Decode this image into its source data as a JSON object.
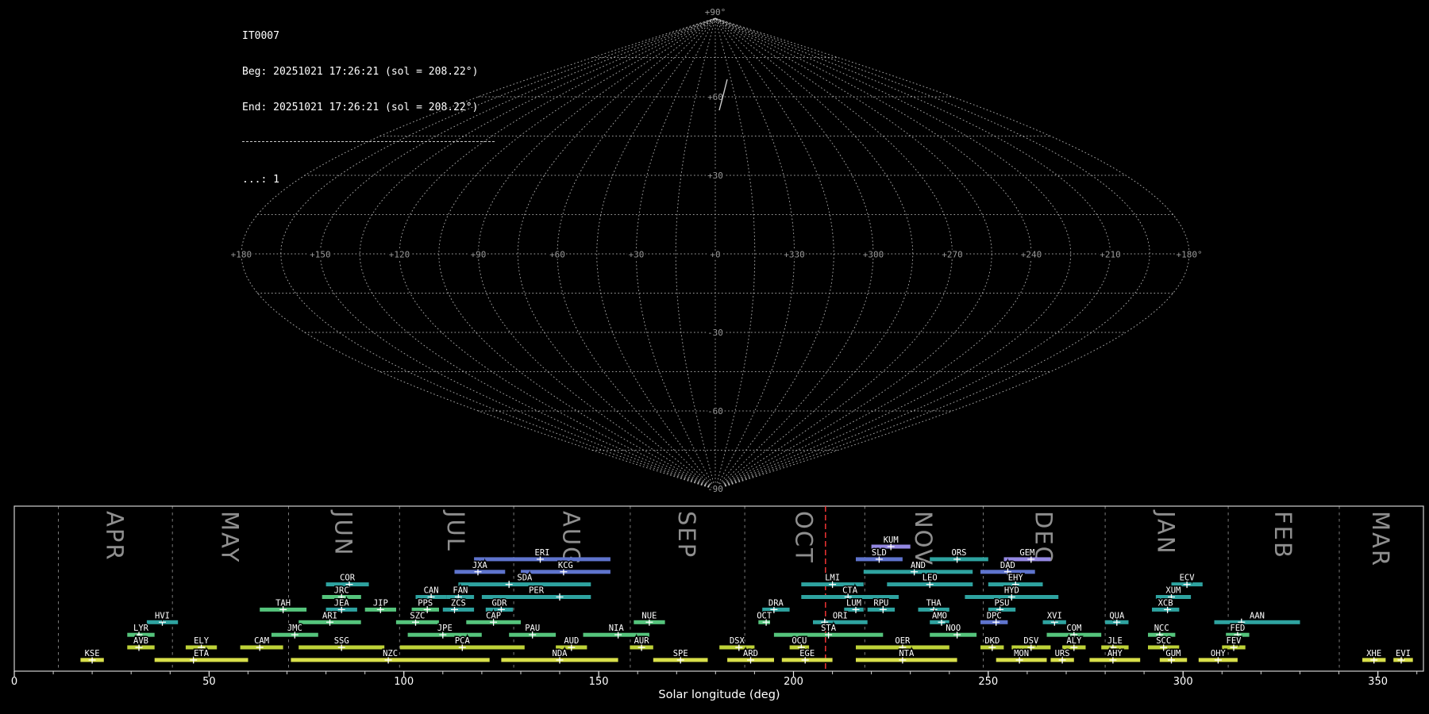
{
  "header": {
    "station": "IT0007",
    "beg_line": "Beg: 20251021 17:26:21 (sol = 208.22°)",
    "end_line": "End: 20251021 17:26:21 (sol = 208.22°)",
    "count_line": "...: 1"
  },
  "sky_map": {
    "projection": "sinusoidal",
    "grid_step_deg": 15,
    "grid_color": "#c9c9c9",
    "label_color": "#9a9a9a",
    "lon_labels": [
      {
        "lon": 180,
        "text": "+180"
      },
      {
        "lon": 150,
        "text": "+150"
      },
      {
        "lon": 120,
        "text": "+120"
      },
      {
        "lon": 90,
        "text": "+90"
      },
      {
        "lon": 60,
        "text": "+60"
      },
      {
        "lon": 30,
        "text": "+30"
      },
      {
        "lon": 0,
        "text": "+0"
      },
      {
        "lon": -30,
        "text": "+330"
      },
      {
        "lon": -60,
        "text": "+300"
      },
      {
        "lon": -90,
        "text": "+270"
      },
      {
        "lon": -120,
        "text": "+240"
      },
      {
        "lon": -150,
        "text": "+210"
      },
      {
        "lon": -180,
        "text": "+180°"
      }
    ],
    "lat_labels": [
      {
        "lat": 90,
        "text": "+90°"
      },
      {
        "lat": 60,
        "text": "+60"
      },
      {
        "lat": 30,
        "text": "+30"
      },
      {
        "lat": -30,
        "text": "-30"
      },
      {
        "lat": -60,
        "text": "-60"
      },
      {
        "lat": -90,
        "text": "-90"
      }
    ],
    "track_points": [
      [
        916,
        100
      ],
      [
        911,
        120
      ],
      [
        906,
        139
      ]
    ],
    "track_color": "#d8d8d8"
  },
  "chart_data": {
    "type": "gantt-timeline",
    "title": "Meteor shower activity periods vs solar longitude",
    "xlabel": "Solar longitude (deg)",
    "x_range": [
      0,
      361.7
    ],
    "x_major_ticks": [
      0,
      50,
      100,
      150,
      200,
      250,
      300,
      350
    ],
    "x_minor_step": 10,
    "grid": "month-boundaries-dashed",
    "current_solar_longitude": 208.22,
    "current_line_color": "#f03434",
    "frame_color": "#d0d0d0",
    "month_line_color": "#909090",
    "month_label_color": "#8f8f8f",
    "shower_label_color": "#ffffff",
    "months": [
      {
        "label": "APR",
        "start": 11.3,
        "end": 40.6
      },
      {
        "label": "MAY",
        "start": 40.6,
        "end": 70.4
      },
      {
        "label": "JUN",
        "start": 70.4,
        "end": 98.9
      },
      {
        "label": "JUL",
        "start": 98.9,
        "end": 128.2
      },
      {
        "label": "AUG",
        "start": 128.2,
        "end": 158.1
      },
      {
        "label": "SEP",
        "start": 158.1,
        "end": 187.5
      },
      {
        "label": "OCT",
        "start": 187.5,
        "end": 218.3
      },
      {
        "label": "NOV",
        "start": 218.3,
        "end": 248.7
      },
      {
        "label": "DEC",
        "start": 248.7,
        "end": 280.0
      },
      {
        "label": "JAN",
        "start": 280.0,
        "end": 311.6
      },
      {
        "label": "FEB",
        "start": 311.6,
        "end": 340.1
      },
      {
        "label": "MAR",
        "start": 340.1,
        "end": 361.7
      }
    ],
    "palette": {
      "yellow": "#d8df4a",
      "chartreuse": "#bed238",
      "green": "#55c47c",
      "teal": "#2ea3a0",
      "blue": "#5f74cd",
      "purple": "#9488e2"
    },
    "showers": [
      {
        "code": "KUM",
        "row": 0,
        "start": 220,
        "end": 230,
        "peak": 225,
        "color": "purple"
      },
      {
        "code": "ERI",
        "row": 1,
        "start": 118,
        "end": 153,
        "peak": 135,
        "color": "blue"
      },
      {
        "code": "SLD",
        "row": 1,
        "start": 216,
        "end": 228,
        "peak": 222,
        "color": "blue"
      },
      {
        "code": "ORS",
        "row": 1,
        "start": 235,
        "end": 250,
        "peak": 242,
        "color": "teal"
      },
      {
        "code": "GEM",
        "row": 1,
        "start": 254,
        "end": 266,
        "peak": 261,
        "color": "purple"
      },
      {
        "code": "JXA",
        "row": 2,
        "start": 113,
        "end": 126,
        "peak": 119,
        "color": "blue"
      },
      {
        "code": "KCG",
        "row": 2,
        "start": 130,
        "end": 153,
        "peak": 141,
        "color": "blue"
      },
      {
        "code": "AND",
        "row": 2,
        "start": 218,
        "end": 246,
        "peak": 231,
        "color": "teal"
      },
      {
        "code": "DAD",
        "row": 2,
        "start": 248,
        "end": 262,
        "peak": 255,
        "color": "blue"
      },
      {
        "code": "COR",
        "row": 3,
        "start": 80,
        "end": 91,
        "peak": 86,
        "color": "teal"
      },
      {
        "code": "SDA",
        "row": 3,
        "start": 114,
        "end": 148,
        "peak": 127,
        "color": "teal"
      },
      {
        "code": "LMI",
        "row": 3,
        "start": 202,
        "end": 218,
        "peak": 210,
        "color": "teal"
      },
      {
        "code": "LEO",
        "row": 3,
        "start": 224,
        "end": 246,
        "peak": 235,
        "color": "teal"
      },
      {
        "code": "EHY",
        "row": 3,
        "start": 250,
        "end": 264,
        "peak": 257,
        "color": "teal"
      },
      {
        "code": "ECV",
        "row": 3,
        "start": 297,
        "end": 305,
        "peak": 301,
        "color": "teal"
      },
      {
        "code": "JRC",
        "row": 4,
        "start": 79,
        "end": 89,
        "peak": 84,
        "color": "green"
      },
      {
        "code": "CAN",
        "row": 4,
        "start": 103,
        "end": 111,
        "peak": 107,
        "color": "teal"
      },
      {
        "code": "FAN",
        "row": 4,
        "start": 111,
        "end": 118,
        "peak": 114,
        "color": "teal"
      },
      {
        "code": "PER",
        "row": 4,
        "start": 120,
        "end": 148,
        "peak": 140,
        "color": "teal"
      },
      {
        "code": "CTA",
        "row": 4,
        "start": 202,
        "end": 227,
        "peak": 214,
        "color": "teal"
      },
      {
        "code": "HYD",
        "row": 4,
        "start": 244,
        "end": 268,
        "peak": 256,
        "color": "teal"
      },
      {
        "code": "XUM",
        "row": 4,
        "start": 293,
        "end": 302,
        "peak": 297,
        "color": "teal"
      },
      {
        "code": "TAH",
        "row": 5,
        "start": 63,
        "end": 75,
        "peak": 69,
        "color": "green"
      },
      {
        "code": "JEA",
        "row": 5,
        "start": 80,
        "end": 88,
        "peak": 84,
        "color": "teal"
      },
      {
        "code": "JIP",
        "row": 5,
        "start": 90,
        "end": 98,
        "peak": 94,
        "color": "green"
      },
      {
        "code": "PPS",
        "row": 5,
        "start": 102,
        "end": 109,
        "peak": 106,
        "color": "green"
      },
      {
        "code": "ZCS",
        "row": 5,
        "start": 110,
        "end": 118,
        "peak": 113,
        "color": "teal"
      },
      {
        "code": "GDR",
        "row": 5,
        "start": 121,
        "end": 128,
        "peak": 125,
        "color": "teal"
      },
      {
        "code": "DRA",
        "row": 5,
        "start": 192,
        "end": 199,
        "peak": 195,
        "color": "teal"
      },
      {
        "code": "LUM",
        "row": 5,
        "start": 213,
        "end": 218,
        "peak": 216,
        "color": "teal"
      },
      {
        "code": "RPU",
        "row": 5,
        "start": 219,
        "end": 226,
        "peak": 223,
        "color": "teal"
      },
      {
        "code": "THA",
        "row": 5,
        "start": 232,
        "end": 240,
        "peak": 236,
        "color": "teal"
      },
      {
        "code": "PSU",
        "row": 5,
        "start": 250,
        "end": 257,
        "peak": 253,
        "color": "teal"
      },
      {
        "code": "XCB",
        "row": 5,
        "start": 292,
        "end": 299,
        "peak": 296,
        "color": "teal"
      },
      {
        "code": "HVI",
        "row": 6,
        "start": 34,
        "end": 42,
        "peak": 38,
        "color": "teal"
      },
      {
        "code": "ARI",
        "row": 6,
        "start": 73,
        "end": 89,
        "peak": 81,
        "color": "green"
      },
      {
        "code": "SZC",
        "row": 6,
        "start": 98,
        "end": 109,
        "peak": 103,
        "color": "green"
      },
      {
        "code": "CAP",
        "row": 6,
        "start": 116,
        "end": 130,
        "peak": 123,
        "color": "green"
      },
      {
        "code": "NUE",
        "row": 6,
        "start": 159,
        "end": 167,
        "peak": 163,
        "color": "green"
      },
      {
        "code": "OCT",
        "row": 6,
        "start": 191,
        "end": 194,
        "peak": 193,
        "color": "green"
      },
      {
        "code": "ORI",
        "row": 6,
        "start": 205,
        "end": 219,
        "peak": 208,
        "color": "teal"
      },
      {
        "code": "AMO",
        "row": 6,
        "start": 235,
        "end": 240,
        "peak": 238,
        "color": "teal"
      },
      {
        "code": "DPC",
        "row": 6,
        "start": 248,
        "end": 255,
        "peak": 252,
        "color": "blue"
      },
      {
        "code": "XVI",
        "row": 6,
        "start": 264,
        "end": 270,
        "peak": 267,
        "color": "teal"
      },
      {
        "code": "QUA",
        "row": 6,
        "start": 280,
        "end": 286,
        "peak": 283,
        "color": "teal"
      },
      {
        "code": "AAN",
        "row": 6,
        "start": 308,
        "end": 330,
        "peak": 315,
        "color": "teal"
      },
      {
        "code": "LYR",
        "row": 7,
        "start": 29,
        "end": 36,
        "peak": 32,
        "color": "green"
      },
      {
        "code": "JMC",
        "row": 7,
        "start": 66,
        "end": 78,
        "peak": 72,
        "color": "green"
      },
      {
        "code": "JPE",
        "row": 7,
        "start": 101,
        "end": 120,
        "peak": 110,
        "color": "green"
      },
      {
        "code": "PAU",
        "row": 7,
        "start": 127,
        "end": 139,
        "peak": 133,
        "color": "green"
      },
      {
        "code": "NIA",
        "row": 7,
        "start": 146,
        "end": 163,
        "peak": 155,
        "color": "green"
      },
      {
        "code": "STA",
        "row": 7,
        "start": 195,
        "end": 223,
        "peak": 209,
        "color": "green"
      },
      {
        "code": "NOO",
        "row": 7,
        "start": 235,
        "end": 247,
        "peak": 242,
        "color": "green"
      },
      {
        "code": "COM",
        "row": 7,
        "start": 265,
        "end": 279,
        "peak": 272,
        "color": "green"
      },
      {
        "code": "NCC",
        "row": 7,
        "start": 291,
        "end": 298,
        "peak": 294,
        "color": "green"
      },
      {
        "code": "FED",
        "row": 7,
        "start": 311,
        "end": 317,
        "peak": 314,
        "color": "green"
      },
      {
        "code": "AVB",
        "row": 8,
        "start": 29,
        "end": 36,
        "peak": 32,
        "color": "chartreuse"
      },
      {
        "code": "ELY",
        "row": 8,
        "start": 44,
        "end": 52,
        "peak": 48,
        "color": "chartreuse"
      },
      {
        "code": "CAM",
        "row": 8,
        "start": 58,
        "end": 69,
        "peak": 63,
        "color": "chartreuse"
      },
      {
        "code": "SSG",
        "row": 8,
        "start": 73,
        "end": 95,
        "peak": 84,
        "color": "chartreuse"
      },
      {
        "code": "PCA",
        "row": 8,
        "start": 99,
        "end": 131,
        "peak": 115,
        "color": "chartreuse"
      },
      {
        "code": "AUD",
        "row": 8,
        "start": 139,
        "end": 147,
        "peak": 143,
        "color": "chartreuse"
      },
      {
        "code": "AUR",
        "row": 8,
        "start": 158,
        "end": 164,
        "peak": 161,
        "color": "chartreuse"
      },
      {
        "code": "DSX",
        "row": 8,
        "start": 181,
        "end": 190,
        "peak": 186,
        "color": "chartreuse"
      },
      {
        "code": "OCU",
        "row": 8,
        "start": 199,
        "end": 204,
        "peak": 202,
        "color": "chartreuse"
      },
      {
        "code": "OER",
        "row": 8,
        "start": 216,
        "end": 240,
        "peak": 228,
        "color": "chartreuse"
      },
      {
        "code": "DKD",
        "row": 8,
        "start": 248,
        "end": 254,
        "peak": 251,
        "color": "chartreuse"
      },
      {
        "code": "DSV",
        "row": 8,
        "start": 256,
        "end": 266,
        "peak": 261,
        "color": "chartreuse"
      },
      {
        "code": "ALY",
        "row": 8,
        "start": 269,
        "end": 275,
        "peak": 272,
        "color": "chartreuse"
      },
      {
        "code": "JLE",
        "row": 8,
        "start": 279,
        "end": 286,
        "peak": 282,
        "color": "chartreuse"
      },
      {
        "code": "SCC",
        "row": 8,
        "start": 291,
        "end": 299,
        "peak": 295,
        "color": "chartreuse"
      },
      {
        "code": "FEV",
        "row": 8,
        "start": 310,
        "end": 316,
        "peak": 313,
        "color": "chartreuse"
      },
      {
        "code": "KSE",
        "row": 9,
        "start": 17,
        "end": 23,
        "peak": 20,
        "color": "yellow"
      },
      {
        "code": "ETA",
        "row": 9,
        "start": 36,
        "end": 60,
        "peak": 46,
        "color": "yellow"
      },
      {
        "code": "NZC",
        "row": 9,
        "start": 71,
        "end": 122,
        "peak": 96,
        "color": "yellow"
      },
      {
        "code": "NDA",
        "row": 9,
        "start": 125,
        "end": 155,
        "peak": 140,
        "color": "yellow"
      },
      {
        "code": "SPE",
        "row": 9,
        "start": 164,
        "end": 178,
        "peak": 171,
        "color": "yellow"
      },
      {
        "code": "ARD",
        "row": 9,
        "start": 183,
        "end": 195,
        "peak": 189,
        "color": "yellow"
      },
      {
        "code": "EGE",
        "row": 9,
        "start": 197,
        "end": 210,
        "peak": 203,
        "color": "yellow"
      },
      {
        "code": "NTA",
        "row": 9,
        "start": 216,
        "end": 242,
        "peak": 228,
        "color": "yellow"
      },
      {
        "code": "MON",
        "row": 9,
        "start": 252,
        "end": 265,
        "peak": 258,
        "color": "yellow"
      },
      {
        "code": "URS",
        "row": 9,
        "start": 266,
        "end": 272,
        "peak": 269,
        "color": "yellow"
      },
      {
        "code": "AHY",
        "row": 9,
        "start": 276,
        "end": 289,
        "peak": 282,
        "color": "yellow"
      },
      {
        "code": "GUM",
        "row": 9,
        "start": 294,
        "end": 301,
        "peak": 297,
        "color": "yellow"
      },
      {
        "code": "OHY",
        "row": 9,
        "start": 304,
        "end": 314,
        "peak": 309,
        "color": "yellow"
      },
      {
        "code": "XHE",
        "row": 9,
        "start": 346,
        "end": 352,
        "peak": 349,
        "color": "yellow"
      },
      {
        "code": "EVI",
        "row": 9,
        "start": 354,
        "end": 359,
        "peak": 356,
        "color": "yellow"
      }
    ]
  }
}
